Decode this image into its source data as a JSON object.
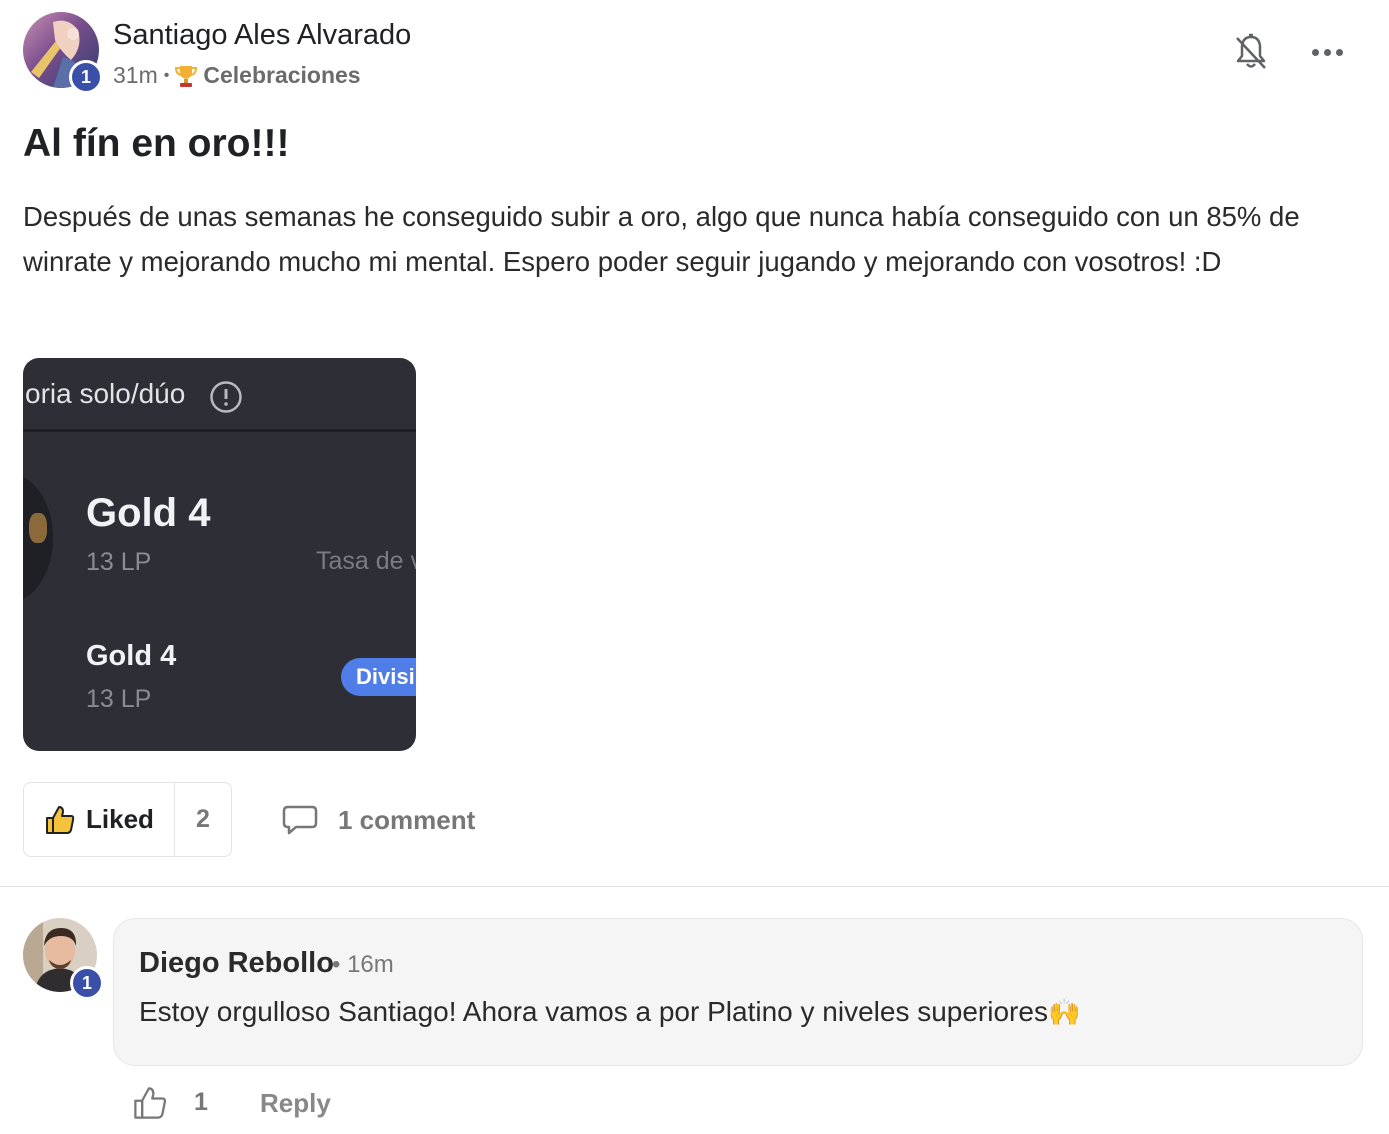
{
  "post": {
    "author": "Santiago Ales Alvarado",
    "author_level": "1",
    "time": "31m",
    "separator": "•",
    "category_icon": "trophy-emoji",
    "category": "Celebraciones",
    "title": "Al fín en oro!!!",
    "body": "Después de unas semanas he conseguido subir a oro, algo que nunca había conseguido con un 85% de winrate y mejorando mucho mi mental. Espero poder seguir jugando y mejorando con vosotros! :D",
    "image": {
      "header_text": "oria solo/dúo",
      "rank_main": "Gold 4",
      "lp_main": "13 LP",
      "winrate_label": "Tasa de v",
      "rank_secondary": "Gold 4",
      "lp_secondary": "13 LP",
      "pill_text": "Divisi",
      "pill_color": "#4f7ee8",
      "bg_color": "#2d2e36"
    },
    "actions": {
      "liked_label": "Liked",
      "like_count": "2",
      "comment_label": "1 comment"
    }
  },
  "comment": {
    "author": "Diego Rebollo",
    "author_level": "1",
    "time": "• 16m",
    "text": "Estoy orgulloso Santiago! Ahora vamos a por Platino y niveles superiores",
    "emoji": "🙌",
    "like_count": "1",
    "reply_label": "Reply"
  },
  "colors": {
    "badge": "#3a4fa8",
    "like_icon_fill": "#f5c33b",
    "muted_text": "#777777",
    "comment_bg": "#f5f5f5"
  }
}
